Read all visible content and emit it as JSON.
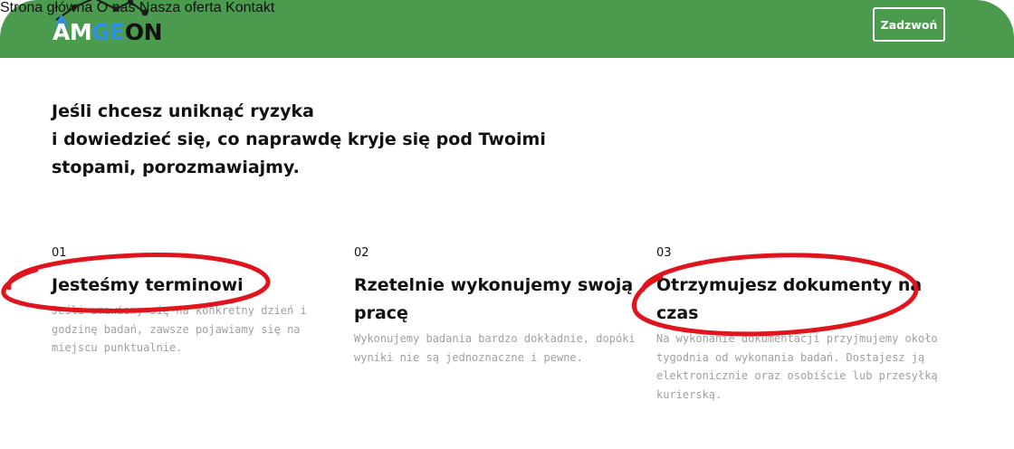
{
  "header": {
    "logo": {
      "part_a": "A",
      "part_m": "M",
      "part_ge": "GE",
      "part_on": "ON"
    },
    "nav": [
      "Strona główna",
      "O nas",
      "Nasza oferta",
      "Kontakt"
    ],
    "cta_label": "Zadzwoń"
  },
  "main": {
    "headline_lines": [
      "Jeśli chcesz uniknąć ryzyka",
      "i dowiedzieć się, co naprawdę kryje się pod Twoimi",
      "stopami, porozmawiajmy."
    ],
    "features": [
      {
        "number": "01",
        "title_lines": [
          "Jesteśmy terminowi"
        ],
        "desc_lines": [
          "Jeśli umawiamy się na konkretny dzień i",
          "godzinę badań, zawsze pojawiamy się na",
          "miejscu punktualnie."
        ]
      },
      {
        "number": "02",
        "title_lines": [
          "Rzetelnie wykonujemy swoją",
          "pracę"
        ],
        "desc_lines": [
          "Wykonujemy badania bardzo dokładnie, dopóki",
          "wyniki nie są jednoznaczne i pewne."
        ]
      },
      {
        "number": "03",
        "title_lines": [
          "Otrzymujesz dokumenty na",
          "czas"
        ],
        "desc_lines": [
          "Na wykonanie dokumentacji przyjmujemy około",
          "tygodnia od wykonania badań. Dostajesz ją",
          "elektronicznie oraz osobiście lub przesyłką",
          "kurierską."
        ]
      }
    ]
  },
  "colors": {
    "header_bg": "#4a9b4e",
    "logo_blue": "#2f8fe0",
    "annotation_red": "#e0141c",
    "desc_gray": "#a0a0a0"
  }
}
